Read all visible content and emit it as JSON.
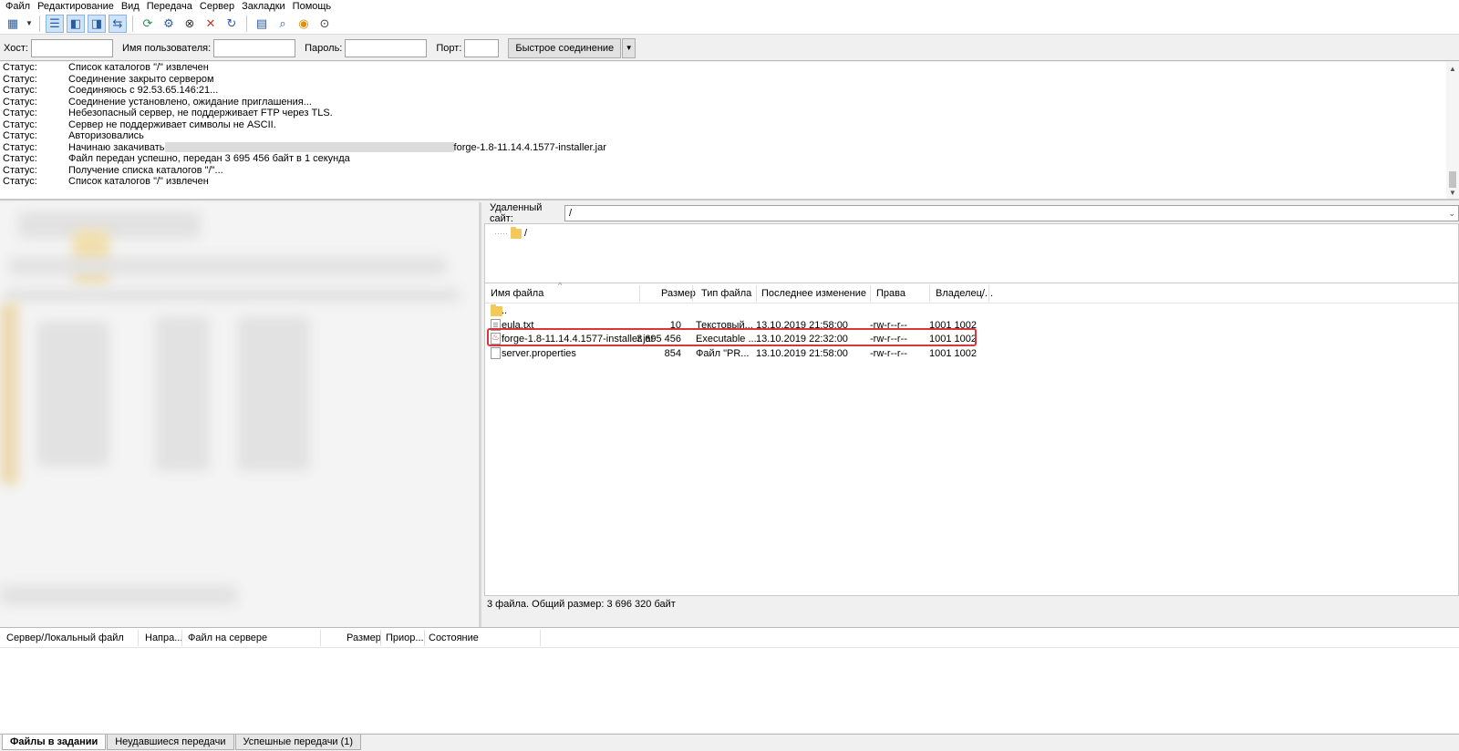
{
  "menu": [
    "Файл",
    "Редактирование",
    "Вид",
    "Передача",
    "Сервер",
    "Закладки",
    "Помощь"
  ],
  "quickconnect": {
    "host_label": "Хост:",
    "user_label": "Имя пользователя:",
    "pass_label": "Пароль:",
    "port_label": "Порт:",
    "host_value": "",
    "user_value": "",
    "pass_value": "",
    "port_value": "",
    "connect_button": "Быстрое соединение"
  },
  "log": [
    {
      "label": "Статус:",
      "message": "Список каталогов \"/\" извлечен"
    },
    {
      "label": "Статус:",
      "message": "Соединение закрыто сервером"
    },
    {
      "label": "Статус:",
      "message": "Соединяюсь с 92.53.65.146:21..."
    },
    {
      "label": "Статус:",
      "message": "Соединение установлено, ожидание приглашения..."
    },
    {
      "label": "Статус:",
      "message": "Небезопасный сервер, не поддерживает FTP через TLS."
    },
    {
      "label": "Статус:",
      "message": "Сервер не поддерживает символы не ASCII."
    },
    {
      "label": "Статус:",
      "message": "Авторизовались"
    },
    {
      "label": "Статус:",
      "message": "Начинаю закачивать",
      "suffix": "forge-1.8-11.14.4.1577-installer.jar"
    },
    {
      "label": "Статус:",
      "message": "Файл передан успешно, передан 3 695 456 байт в 1 секунда"
    },
    {
      "label": "Статус:",
      "message": "Получение списка каталогов \"/\"..."
    },
    {
      "label": "Статус:",
      "message": "Список каталогов \"/\" извлечен"
    }
  ],
  "remote": {
    "site_label": "Удаленный сайт:",
    "path": "/",
    "tree_root": "/",
    "columns": {
      "name": "Имя файла",
      "size": "Размер",
      "type": "Тип файла",
      "modified": "Последнее изменение",
      "perms": "Права",
      "owner": "Владелец/..."
    },
    "files": [
      {
        "name": "..",
        "size": "",
        "type": "",
        "modified": "",
        "perms": "",
        "owner": "",
        "icon": "folder-icon"
      },
      {
        "name": "eula.txt",
        "size": "10",
        "type": "Текстовый...",
        "modified": "13.10.2019 21:58:00",
        "perms": "-rw-r--r--",
        "owner": "1001 1002",
        "icon": "text-file-icon"
      },
      {
        "name": "forge-1.8-11.14.4.1577-installer.jar",
        "size": "3 695 456",
        "type": "Executable ...",
        "modified": "13.10.2019 22:32:00",
        "perms": "-rw-r--r--",
        "owner": "1001 1002",
        "icon": "jar-file-icon"
      },
      {
        "name": "server.properties",
        "size": "854",
        "type": "Файл \"PR...",
        "modified": "13.10.2019 21:58:00",
        "perms": "-rw-r--r--",
        "owner": "1001 1002",
        "icon": "file-icon"
      }
    ],
    "status": "3 файла. Общий размер: 3 696 320 байт"
  },
  "queue": {
    "columns": {
      "server_local": "Сервер/Локальный файл",
      "direction": "Напра...",
      "remote_file": "Файл на сервере",
      "size": "Размер",
      "priority": "Приор...",
      "state": "Состояние"
    }
  },
  "tabs": [
    "Файлы в задании",
    "Неудавшиеся передачи",
    "Успешные передачи (1)"
  ],
  "colors": {
    "highlight": "#d9353b",
    "folder": "#f3c95c"
  }
}
